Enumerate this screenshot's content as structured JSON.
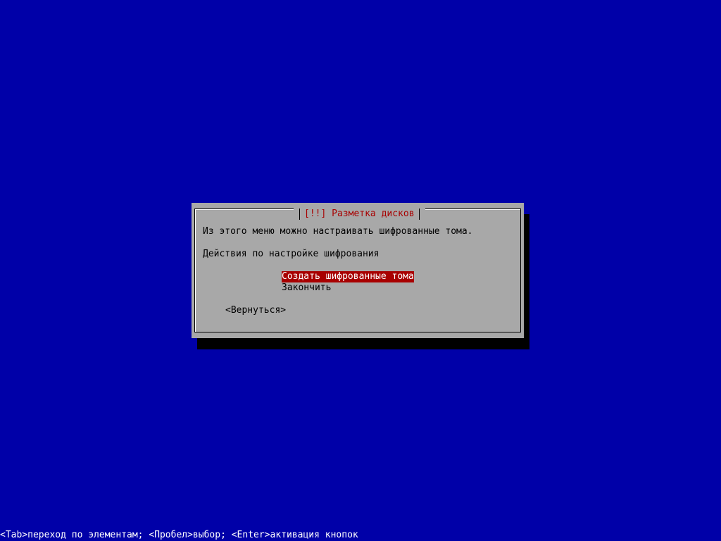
{
  "colors": {
    "background": "#0000a8",
    "dialog": "#a8a8a8",
    "title": "#a80000",
    "selected_bg": "#a80000",
    "selected_fg": "#ffffff",
    "help_text": "#ffffff"
  },
  "dialog": {
    "title": "[!!] Разметка дисков",
    "description": "Из этого меню можно настраивать шифрованные тома.",
    "prompt": "Действия по настройке шифрования",
    "menu": [
      {
        "label": "Создать шифрованные тома",
        "selected": true
      },
      {
        "label": "Закончить",
        "selected": false
      }
    ],
    "back_button": "<Вернуться>"
  },
  "help_line": "<Tab>переход по элементам; <Пробел>выбор; <Enter>активация кнопок"
}
